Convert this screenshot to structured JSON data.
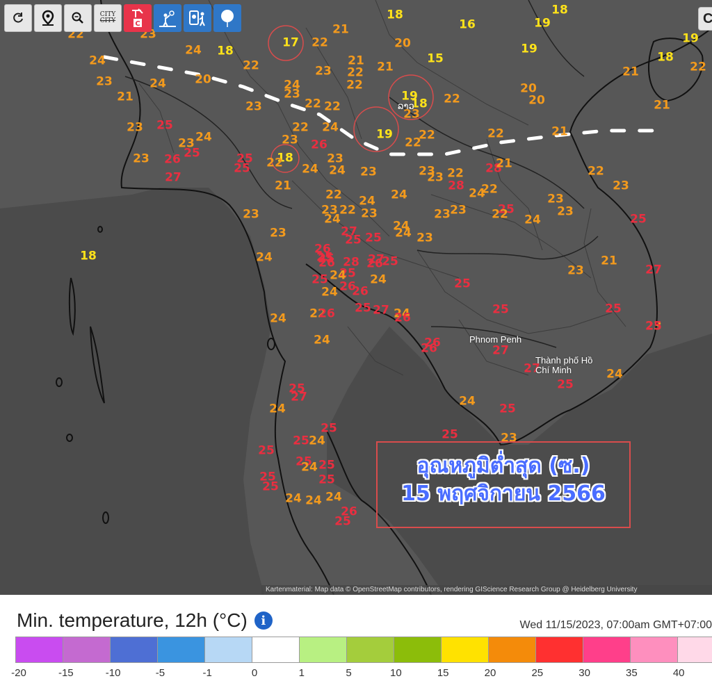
{
  "toolbar": {
    "buttons": [
      {
        "id": "refresh",
        "icon": "refresh-icon"
      },
      {
        "id": "locate",
        "icon": "map-pin-icon"
      },
      {
        "id": "zoom",
        "icon": "zoom-icon"
      },
      {
        "id": "city",
        "icon": "city-toggle-icon",
        "label_top": "CITY",
        "label_bottom": "CITY"
      },
      {
        "id": "station",
        "icon": "weather-station-icon",
        "badge": "C"
      },
      {
        "id": "observer",
        "icon": "observer-icon"
      },
      {
        "id": "report",
        "icon": "report-icon"
      },
      {
        "id": "balloon",
        "icon": "balloon-icon"
      }
    ],
    "corner_label": "C"
  },
  "map": {
    "places": [
      {
        "name": "Phnom Penh"
      },
      {
        "name": "Thành phố Hồ Chí Minh"
      }
    ],
    "lao_label": "ລາວ",
    "temperatures": [
      {
        "v": "18"
      },
      {
        "v": "16"
      },
      {
        "v": "18"
      },
      {
        "v": "19"
      },
      {
        "v": "19"
      },
      {
        "v": "22"
      },
      {
        "v": "23"
      },
      {
        "v": "17"
      },
      {
        "v": "22"
      },
      {
        "v": "21"
      },
      {
        "v": "20"
      },
      {
        "v": "15"
      },
      {
        "v": "19"
      },
      {
        "v": "18"
      },
      {
        "v": "22"
      },
      {
        "v": "24"
      },
      {
        "v": "18"
      },
      {
        "v": "24"
      },
      {
        "v": "22"
      },
      {
        "v": "23"
      },
      {
        "v": "21"
      },
      {
        "v": "22"
      },
      {
        "v": "21"
      },
      {
        "v": "21"
      },
      {
        "v": "23"
      },
      {
        "v": "24"
      },
      {
        "v": "20"
      },
      {
        "v": "22"
      },
      {
        "v": "24"
      },
      {
        "v": "23"
      },
      {
        "v": "20"
      },
      {
        "v": "20"
      },
      {
        "v": "21"
      },
      {
        "v": "22"
      },
      {
        "v": "19"
      },
      {
        "v": "18"
      },
      {
        "v": "23"
      },
      {
        "v": "22"
      },
      {
        "v": "22"
      },
      {
        "v": "23"
      },
      {
        "v": "21"
      },
      {
        "v": "23"
      },
      {
        "v": "25"
      },
      {
        "v": "22"
      },
      {
        "v": "24"
      },
      {
        "v": "19"
      },
      {
        "v": "22"
      },
      {
        "v": "22"
      },
      {
        "v": "21"
      },
      {
        "v": "23"
      },
      {
        "v": "23"
      },
      {
        "v": "26"
      },
      {
        "v": "25"
      },
      {
        "v": "25"
      },
      {
        "v": "18"
      },
      {
        "v": "24"
      },
      {
        "v": "26"
      },
      {
        "v": "23"
      },
      {
        "v": "22"
      },
      {
        "v": "28"
      },
      {
        "v": "21"
      },
      {
        "v": "22"
      },
      {
        "v": "25"
      },
      {
        "v": "27"
      },
      {
        "v": "21"
      },
      {
        "v": "24"
      },
      {
        "v": "24"
      },
      {
        "v": "23"
      },
      {
        "v": "23"
      },
      {
        "v": "22"
      },
      {
        "v": "28"
      },
      {
        "v": "23"
      },
      {
        "v": "22"
      },
      {
        "v": "23"
      },
      {
        "v": "24"
      },
      {
        "v": "24"
      },
      {
        "v": "22"
      },
      {
        "v": "22"
      },
      {
        "v": "23"
      },
      {
        "v": "24"
      },
      {
        "v": "23"
      },
      {
        "v": "23"
      },
      {
        "v": "22"
      },
      {
        "v": "25"
      },
      {
        "v": "23"
      },
      {
        "v": "27"
      },
      {
        "v": "24"
      },
      {
        "v": "23"
      },
      {
        "v": "22"
      },
      {
        "v": "23"
      },
      {
        "v": "23"
      },
      {
        "v": "23"
      },
      {
        "v": "18"
      },
      {
        "v": "24"
      },
      {
        "v": "25"
      },
      {
        "v": "26"
      },
      {
        "v": "24"
      },
      {
        "v": "23"
      },
      {
        "v": "21"
      },
      {
        "v": "24"
      },
      {
        "v": "25"
      },
      {
        "v": "25"
      },
      {
        "v": "26"
      },
      {
        "v": "24"
      },
      {
        "v": "25"
      },
      {
        "v": "23"
      },
      {
        "v": "27"
      },
      {
        "v": "25"
      },
      {
        "v": "24"
      },
      {
        "v": "28"
      },
      {
        "v": "25"
      },
      {
        "v": "24"
      },
      {
        "v": "25"
      },
      {
        "v": "27"
      },
      {
        "v": "23"
      },
      {
        "v": "26"
      },
      {
        "v": "24"
      },
      {
        "v": "22"
      },
      {
        "v": "26"
      },
      {
        "v": "26"
      },
      {
        "v": "27"
      },
      {
        "v": "25"
      },
      {
        "v": "25"
      },
      {
        "v": "24"
      },
      {
        "v": "24"
      },
      {
        "v": "26"
      },
      {
        "v": "25"
      },
      {
        "v": "25"
      },
      {
        "v": "25"
      },
      {
        "v": "24"
      },
      {
        "v": "23"
      },
      {
        "v": "26"
      },
      {
        "v": "25"
      },
      {
        "v": "26"
      },
      {
        "v": "26"
      },
      {
        "v": "27"
      },
      {
        "v": "27"
      },
      {
        "v": "25"
      },
      {
        "v": "24"
      },
      {
        "v": "24"
      },
      {
        "v": "25"
      },
      {
        "v": "25"
      },
      {
        "v": "23"
      },
      {
        "v": "25"
      },
      {
        "v": "27"
      },
      {
        "v": "24"
      },
      {
        "v": "25"
      },
      {
        "v": "25"
      },
      {
        "v": "24"
      },
      {
        "v": "25"
      },
      {
        "v": "25"
      },
      {
        "v": "25"
      },
      {
        "v": "24"
      },
      {
        "v": "25"
      },
      {
        "v": "25"
      },
      {
        "v": "25"
      },
      {
        "v": "24"
      },
      {
        "v": "24"
      },
      {
        "v": "24"
      },
      {
        "v": "26"
      },
      {
        "v": "25"
      }
    ],
    "attribution": "Kartenmaterial: Map data © OpenStreetMap contributors, rendering GIScience Research Group @ Heidelberg University"
  },
  "title_box": {
    "line1": "อุณหภูมิต่ำสุด (ซ.)",
    "line2": "15 พฤศจิกายน 2566"
  },
  "legend": {
    "title": "Min. temperature, 12h (°C)",
    "info_icon": "info-icon",
    "date": "Wed 11/15/2023, 07:00am GMT+07:00",
    "colors": [
      "#c94cf0",
      "#c46ad0",
      "#4e6fd4",
      "#3a94e0",
      "#b7d8f5",
      "#ffffff",
      "#b8f082",
      "#a4cd3c",
      "#8cbd0a",
      "#ffe200",
      "#f48b0a",
      "#ff3030",
      "#ff3f8a",
      "#fe8fbe",
      "#ffd9e8"
    ],
    "ticks": [
      "-20",
      "-15",
      "-10",
      "-5",
      "-1",
      "0",
      "1",
      "5",
      "10",
      "15",
      "20",
      "25",
      "30",
      "35",
      "40"
    ]
  },
  "palette": {
    "map_bg": "#575757",
    "yellow": "#ffe21a",
    "orange": "#f39a1d",
    "red": "#ea2e40",
    "title_blue": "#4a6dff",
    "highlight_circle": "#d94c4c"
  }
}
